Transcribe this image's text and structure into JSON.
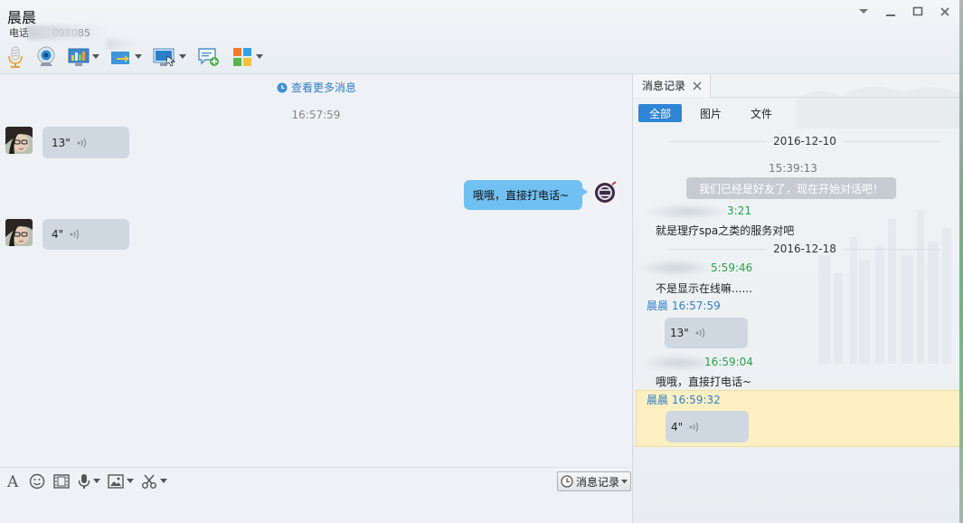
{
  "window": {
    "title": "晨晨",
    "phone_label": "电话",
    "phone_visible": "098085"
  },
  "toolbar": {
    "items": [
      "microphone-icon",
      "webcam-icon",
      "screen-share-icon",
      "file-transfer-icon",
      "remote-assist-icon",
      "new-chat-icon",
      "apps-icon"
    ]
  },
  "chat": {
    "more_messages": "查看更多消息",
    "timestamp": "16:57:59",
    "messages": [
      {
        "direction": "in",
        "type": "voice",
        "duration": "13\""
      },
      {
        "direction": "out",
        "type": "text",
        "text": "哦哦，直接打电话~"
      },
      {
        "direction": "in",
        "type": "voice",
        "duration": "4\""
      }
    ]
  },
  "input_toolbar": {
    "history_button": "消息记录"
  },
  "history": {
    "tab_label": "消息记录",
    "filters": [
      "全部",
      "图片",
      "文件"
    ],
    "active_filter": "全部",
    "entries": {
      "date1": "2016-12-10",
      "time1": "15:39:13",
      "system_msg": "我们已经是好友了，现在开始对话吧！",
      "sender_time_a": "3:21",
      "text_a": "就是理疗spa之类的服务对吧",
      "date2": "2016-12-18",
      "sender_time_b": "5:59:46",
      "text_b": "不是显示在线嘛......",
      "sender_c_name": "晨晨",
      "sender_c_time": "16:57:59",
      "voice_c": "13\"",
      "sender_time_d": "16:59:04",
      "text_d": "哦哦，直接打电话~",
      "sender_e_name": "晨晨",
      "sender_e_time": "16:59:32",
      "voice_e": "4\""
    }
  },
  "colors": {
    "accent": "#2f84d6",
    "link": "#2f7ec7",
    "out_bubble": "#70c0f2",
    "in_bubble": "#cfd8e1",
    "self_name": "#2aa34a",
    "highlight": "#fcf0c3"
  }
}
